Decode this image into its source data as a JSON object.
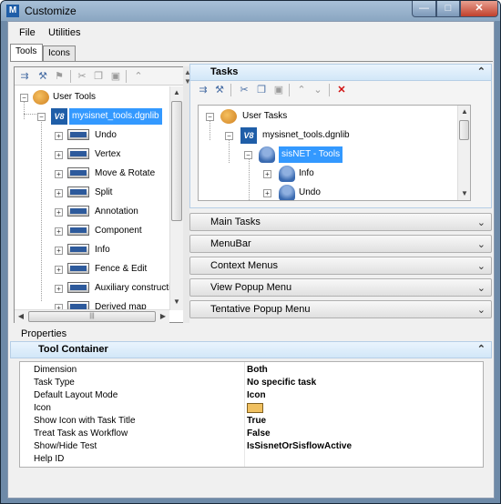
{
  "window": {
    "title": "Customize",
    "app_icon": "microstation-icon",
    "minimize": "—",
    "maximize": "□",
    "close": "✕"
  },
  "menu": [
    "File",
    "Utilities"
  ],
  "tabs": [
    "Tools",
    "Icons"
  ],
  "left_tree": [
    {
      "label": "User Tools",
      "icon": "users-icon"
    },
    {
      "label": "mysisnet_tools.dgnlib",
      "icon": "v8-icon",
      "selected": true
    },
    {
      "label": "Undo"
    },
    {
      "label": "Vertex"
    },
    {
      "label": "Move & Rotate"
    },
    {
      "label": "Split"
    },
    {
      "label": "Annotation"
    },
    {
      "label": "Component"
    },
    {
      "label": "Info"
    },
    {
      "label": "Fence & Edit"
    },
    {
      "label": "Auxiliary constructio"
    },
    {
      "label": "Derived map"
    }
  ],
  "tasks": {
    "header": "Tasks",
    "tree": [
      {
        "label": "User Tasks"
      },
      {
        "label": "mysisnet_tools.dgnlib"
      },
      {
        "label": "sisNET - Tools",
        "selected": true
      },
      {
        "label": "Info"
      },
      {
        "label": "Undo"
      }
    ]
  },
  "collapsed_sections": [
    "Main Tasks",
    "MenuBar",
    "Context Menus",
    "View Popup Menu",
    "Tentative Popup Menu"
  ],
  "properties": {
    "label": "Properties",
    "header": "Tool Container",
    "rows": [
      {
        "name": "Dimension",
        "value": "Both"
      },
      {
        "name": "Task Type",
        "value": "No specific task"
      },
      {
        "name": "Default Layout Mode",
        "value": "Icon"
      },
      {
        "name": "Icon",
        "value": ""
      },
      {
        "name": "Show Icon with Task Title",
        "value": "True"
      },
      {
        "name": "Treat Task as Workflow",
        "value": "False"
      },
      {
        "name": "Show/Hide Test",
        "value": "IsSisnetOrSisflowActive"
      },
      {
        "name": "Help ID",
        "value": ""
      }
    ]
  },
  "glyphs": {
    "collapse": "⌃",
    "expand": "⌄",
    "plus": "+",
    "minus": "−",
    "up": "▲",
    "down": "▼",
    "left": "◀",
    "right": "▶",
    "grip": "|||"
  }
}
